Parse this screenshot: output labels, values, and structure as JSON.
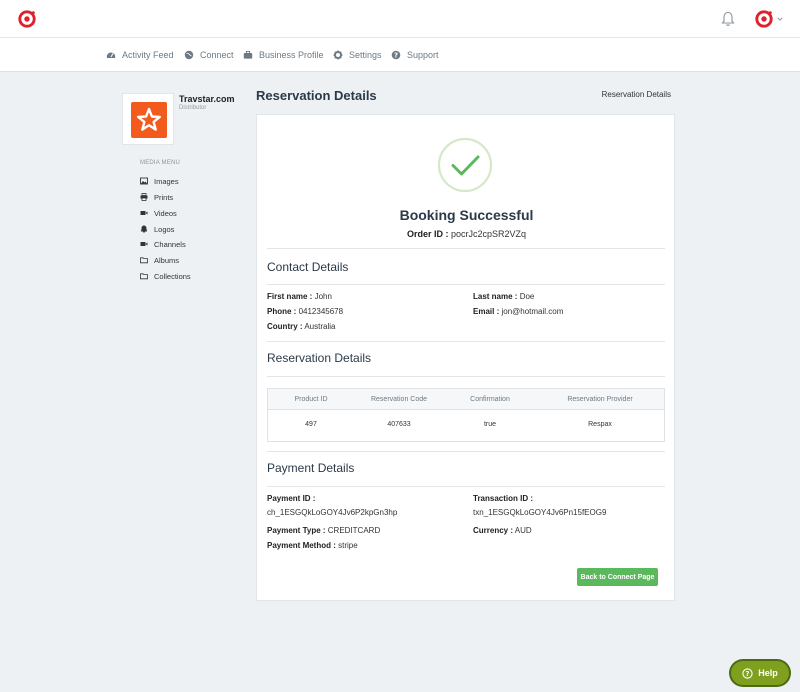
{
  "colors": {
    "brand_red": "#e0212b",
    "brand_orange": "#f25a1e",
    "success_green": "#5cb85c",
    "help_green": "#7fa01f"
  },
  "nav": {
    "items": [
      {
        "label": "Activity Feed",
        "icon": "dashboard-icon"
      },
      {
        "label": "Connect",
        "icon": "globe-icon"
      },
      {
        "label": "Business Profile",
        "icon": "briefcase-icon"
      },
      {
        "label": "Settings",
        "icon": "gear-icon"
      },
      {
        "label": "Support",
        "icon": "question-icon"
      }
    ]
  },
  "profile": {
    "name": "Travstar.com",
    "role": "Distributor",
    "logo_icon": "star-icon"
  },
  "media_menu": {
    "title": "MEDIA MENU",
    "items": [
      {
        "label": "Images",
        "icon": "image-icon"
      },
      {
        "label": "Prints",
        "icon": "print-icon"
      },
      {
        "label": "Videos",
        "icon": "video-icon"
      },
      {
        "label": "Logos",
        "icon": "logo-icon"
      },
      {
        "label": "Channels",
        "icon": "channel-icon"
      },
      {
        "label": "Albums",
        "icon": "folder-icon"
      },
      {
        "label": "Collections",
        "icon": "folder-icon"
      }
    ]
  },
  "page": {
    "title": "Reservation Details",
    "breadcrumb": "Reservation Details"
  },
  "booking": {
    "status": "Booking Successful",
    "order_label": "Order ID :",
    "order_id": "pocrJc2cpSR2VZq"
  },
  "contact": {
    "heading": "Contact Details",
    "first_name_label": "First name :",
    "first_name": "John",
    "last_name_label": "Last name :",
    "last_name": "Doe",
    "phone_label": "Phone :",
    "phone": "0412345678",
    "email_label": "Email :",
    "email": "jon@hotmail.com",
    "country_label": "Country :",
    "country": "Australia"
  },
  "reservation": {
    "heading": "Reservation Details",
    "columns": [
      "Product ID",
      "Reservation Code",
      "Confirmation",
      "Reservation Provider"
    ],
    "rows": [
      [
        "497",
        "407633",
        "true",
        "Respax"
      ]
    ]
  },
  "payment": {
    "heading": "Payment Details",
    "payment_id_label": "Payment ID :",
    "payment_id": "ch_1ESGQkLoGOY4Jv6P2kpGn3hp",
    "transaction_id_label": "Transaction ID :",
    "transaction_id": "txn_1ESGQkLoGOY4Jv6Pn15fEOG9",
    "payment_type_label": "Payment Type :",
    "payment_type": "CREDITCARD",
    "currency_label": "Currency :",
    "currency": "AUD",
    "payment_method_label": "Payment Method :",
    "payment_method": "stripe"
  },
  "back_button": "Back to Connect Page",
  "help_button": "Help"
}
